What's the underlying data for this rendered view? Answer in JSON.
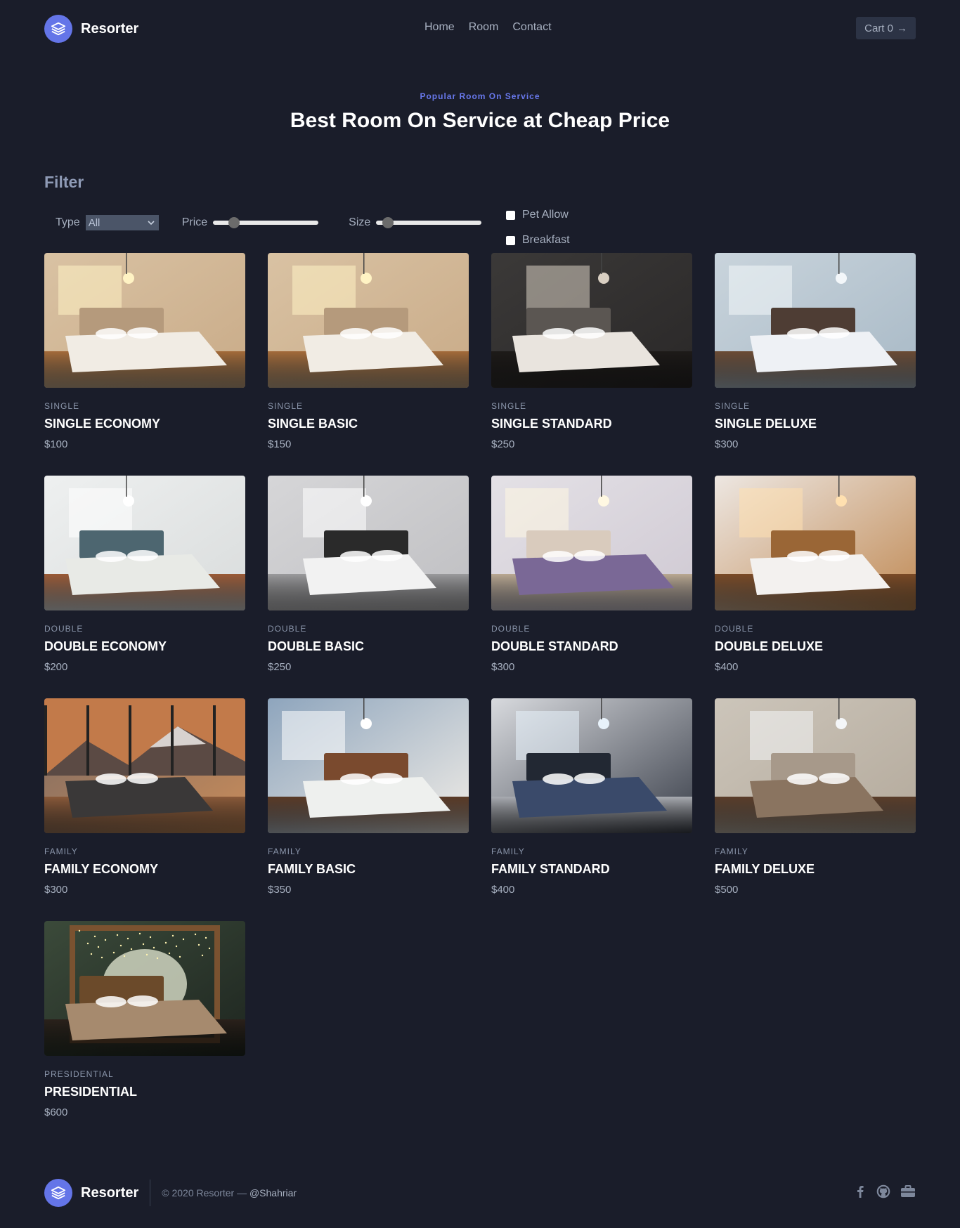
{
  "brand": {
    "name": "Resorter"
  },
  "nav": {
    "home": "Home",
    "room": "Room",
    "contact": "Contact"
  },
  "cart": {
    "label": "Cart 0",
    "arrow": "→"
  },
  "hero": {
    "eyebrow": "Popular Room On Service",
    "title": "Best Room On Service at Cheap Price"
  },
  "filter": {
    "title": "Filter",
    "type_label": "Type",
    "type_value": "All",
    "price_label": "Price",
    "price_level": 0.15,
    "size_label": "Size",
    "size_level": 0.05,
    "pet_label": "Pet Allow",
    "breakfast_label": "Breakfast"
  },
  "rooms": [
    {
      "category": "Single",
      "name": "SINGLE ECONOMY",
      "price": "$100",
      "scene": "warm"
    },
    {
      "category": "Single",
      "name": "SINGLE BASIC",
      "price": "$150",
      "scene": "warm"
    },
    {
      "category": "Single",
      "name": "SINGLE STANDARD",
      "price": "$250",
      "scene": "dark"
    },
    {
      "category": "Single",
      "name": "SINGLE DELUXE",
      "price": "$300",
      "scene": "blue"
    },
    {
      "category": "Double",
      "name": "DOUBLE ECONOMY",
      "price": "$200",
      "scene": "teal"
    },
    {
      "category": "Double",
      "name": "DOUBLE BASIC",
      "price": "$250",
      "scene": "grey"
    },
    {
      "category": "Double",
      "name": "DOUBLE STANDARD",
      "price": "$300",
      "scene": "purple"
    },
    {
      "category": "Double",
      "name": "DOUBLE DELUXE",
      "price": "$400",
      "scene": "wood"
    },
    {
      "category": "Family",
      "name": "FAMILY ECONOMY",
      "price": "$300",
      "scene": "mountain"
    },
    {
      "category": "Family",
      "name": "FAMILY BASIC",
      "price": "$350",
      "scene": "bluewall"
    },
    {
      "category": "Family",
      "name": "FAMILY STANDARD",
      "price": "$400",
      "scene": "navy"
    },
    {
      "category": "Family",
      "name": "FAMILY DELUXE",
      "price": "$500",
      "scene": "beige"
    },
    {
      "category": "Presidential",
      "name": "PRESIDENTIAL",
      "price": "$600",
      "scene": "presidential"
    }
  ],
  "footer": {
    "brand": "Resorter",
    "copyright": "© 2020 Resorter —",
    "handle": "@Shahriar"
  },
  "socials": [
    "facebook-icon",
    "github-icon",
    "briefcase-icon"
  ],
  "colors": {
    "background": "#1a1d2a",
    "accent": "#6475e8",
    "eyebrow": "#6878ec"
  }
}
